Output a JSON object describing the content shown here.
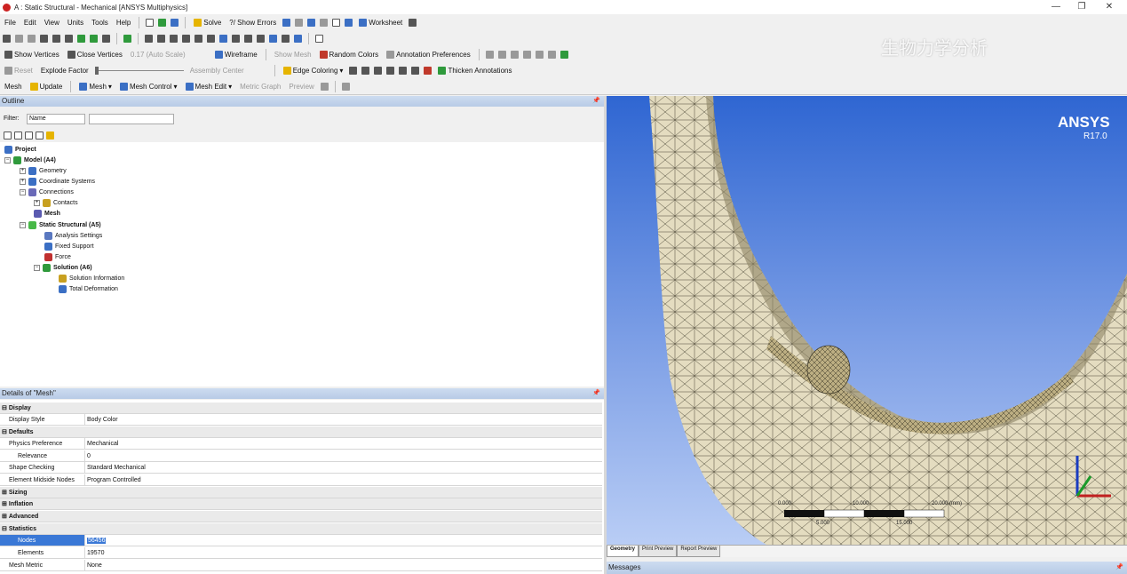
{
  "window": {
    "title": "A : Static Structural - Mechanical [ANSYS Multiphysics]",
    "minimize": "—",
    "restore": "❐",
    "close": "✕"
  },
  "menu": [
    "File",
    "Edit",
    "View",
    "Units",
    "Tools",
    "Help"
  ],
  "toolbar1": {
    "solve": "Solve",
    "show_errors": "?/ Show Errors",
    "worksheet": "Worksheet"
  },
  "toolbar3": {
    "show_vertices": "Show Vertices",
    "close_vertices": "Close Vertices",
    "auto_scale": "0.17 (Auto Scale)",
    "wireframe": "Wireframe",
    "show_mesh": "Show Mesh",
    "random_colors": "Random Colors",
    "annotation_prefs": "Annotation Preferences"
  },
  "toolbar4": {
    "reset": "Reset",
    "explode_factor": "Explode Factor",
    "assembly_center": "Assembly Center",
    "edge_coloring": "Edge Coloring",
    "thicken": "Thicken Annotations"
  },
  "context": {
    "mesh": "Mesh",
    "update": "Update",
    "mesh_btn": "Mesh",
    "mesh_control": "Mesh Control",
    "mesh_edit": "Mesh Edit",
    "metric_graph": "Metric Graph",
    "preview": "Preview"
  },
  "outline": {
    "title": "Outline",
    "filter_label": "Filter:",
    "filter_value": "Name",
    "tree": [
      {
        "label": "Project",
        "bold": true
      },
      {
        "label": "Model (A4)",
        "bold": true
      },
      {
        "label": "Geometry",
        "bold": false
      },
      {
        "label": "Coordinate Systems",
        "bold": false
      },
      {
        "label": "Connections",
        "bold": false
      },
      {
        "label": "Contacts",
        "bold": false
      },
      {
        "label": "Mesh",
        "bold": true
      },
      {
        "label": "Static Structural (A5)",
        "bold": true
      },
      {
        "label": "Analysis Settings",
        "bold": false
      },
      {
        "label": "Fixed Support",
        "bold": false
      },
      {
        "label": "Force",
        "bold": false
      },
      {
        "label": "Solution (A6)",
        "bold": true
      },
      {
        "label": "Solution Information",
        "bold": false
      },
      {
        "label": "Total Deformation",
        "bold": false
      }
    ]
  },
  "details": {
    "title": "Details of \"Mesh\"",
    "rows": [
      {
        "type": "group",
        "label": "Display"
      },
      {
        "type": "prop",
        "key": "Display Style",
        "value": "Body Color"
      },
      {
        "type": "group",
        "label": "Defaults"
      },
      {
        "type": "prop",
        "key": "Physics Preference",
        "value": "Mechanical"
      },
      {
        "type": "prop",
        "key": "Relevance",
        "value": "0"
      },
      {
        "type": "prop",
        "key": "Shape Checking",
        "value": "Standard Mechanical"
      },
      {
        "type": "prop",
        "key": "Element Midside Nodes",
        "value": "Program Controlled"
      },
      {
        "type": "group",
        "label": "Sizing"
      },
      {
        "type": "group",
        "label": "Inflation"
      },
      {
        "type": "group",
        "label": "Advanced"
      },
      {
        "type": "group",
        "label": "Statistics"
      },
      {
        "type": "prop",
        "key": "Nodes",
        "value": "56456",
        "selected": true
      },
      {
        "type": "prop",
        "key": "Elements",
        "value": "19570"
      },
      {
        "type": "prop",
        "key": "Mesh Metric",
        "value": "None"
      }
    ]
  },
  "viewport": {
    "brand": "ANSYS",
    "version": "R17.0",
    "watermark": "生物力学分析",
    "scale_labels": [
      "0.000",
      "10.000",
      "20.000 (mm)",
      "5.000",
      "15.000"
    ],
    "tabs": [
      "Geometry",
      "Print Preview",
      "Report Preview"
    ]
  },
  "messages": {
    "title": "Messages"
  },
  "colors": {
    "panel_header": "#c4d4ec",
    "selection": "#3a78d6",
    "bone": "#e4dcc0",
    "viewport_top": "#2f66d2"
  }
}
